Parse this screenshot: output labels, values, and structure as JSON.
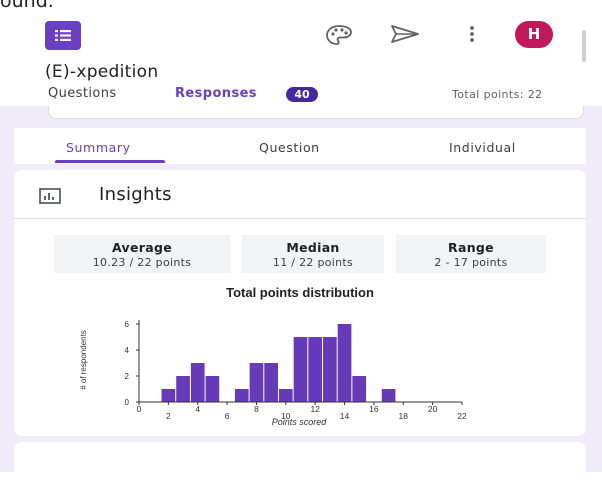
{
  "partial_top_text": "ound.",
  "app": {
    "form_title": "(E)-xpedition",
    "avatar_letter": "H",
    "brand_color": "#6a3fc3",
    "avatar_color": "#c2185b"
  },
  "tabs": {
    "questions": "Questions",
    "responses": "Responses",
    "responses_count": "40",
    "total_points": "Total points: 22"
  },
  "subtabs": {
    "summary": "Summary",
    "question": "Question",
    "individual": "Individual"
  },
  "insights": {
    "title": "Insights",
    "stats": {
      "average_label": "Average",
      "average_value": "10.23 / 22 points",
      "median_label": "Median",
      "median_value": "11 / 22 points",
      "range_label": "Range",
      "range_value": "2 - 17 points"
    }
  },
  "chart_data": {
    "type": "bar",
    "title": "Total points distribution",
    "xlabel": "Points scored",
    "ylabel": "# of respondents",
    "x_ticks": [
      "0",
      "2",
      "4",
      "6",
      "8",
      "10",
      "12",
      "14",
      "16",
      "18",
      "20",
      "22"
    ],
    "y_ticks": [
      "0",
      "2",
      "4",
      "6"
    ],
    "xlim": [
      0,
      22
    ],
    "ylim": [
      0,
      6
    ],
    "bar_color": "#673ab7",
    "points": [
      1,
      2,
      3,
      4,
      5,
      6,
      7,
      8,
      9,
      10,
      11,
      12,
      13,
      14,
      15,
      16,
      17
    ],
    "values": [
      0,
      1,
      2,
      3,
      2,
      0,
      1,
      3,
      3,
      1,
      5,
      5,
      5,
      6,
      2,
      0,
      1
    ],
    "grid": false,
    "legend": "none"
  },
  "icons": [
    "forms-logo-icon",
    "palette-icon",
    "send-icon",
    "more-vert-icon",
    "insights-chart-icon"
  ]
}
